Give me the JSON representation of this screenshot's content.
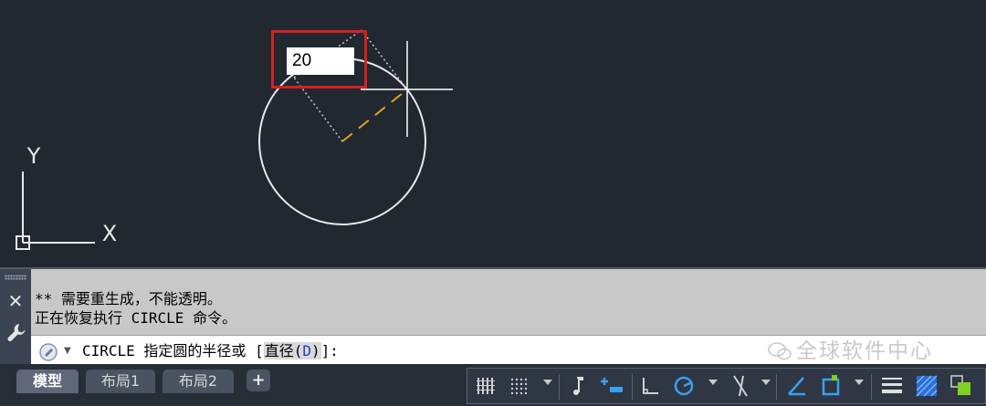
{
  "canvas": {
    "dynamic_input_value": "20",
    "ucs_x_label": "X",
    "ucs_y_label": "Y"
  },
  "command": {
    "history": [
      "** 需要重生成，不能透明。",
      "正在恢复执行 CIRCLE 命令。"
    ],
    "prompt_prefix": "CIRCLE 指定圆的半径或 [",
    "option_label": "直径(",
    "option_key": "D",
    "option_close": ")",
    "prompt_suffix": "]:"
  },
  "watermark": "全球软件中心",
  "tabs": [
    {
      "label": "模型",
      "active": true
    },
    {
      "label": "布局1",
      "active": false
    },
    {
      "label": "布局2",
      "active": false
    }
  ],
  "tab_add_label": "+",
  "colors": {
    "canvas_bg": "#212830",
    "highlight_box": "#d62020",
    "radius_line": "#e0a020",
    "option_key": "#1a3fc4",
    "status_bg": "#272e38"
  },
  "status_tools": [
    "grid-icon",
    "snap-icon",
    "infer-icon",
    "dynamic-input-icon",
    "ortho-icon",
    "polar-icon",
    "isodraft-icon",
    "osnap-track-icon",
    "osnap-icon",
    "lineweight-icon",
    "transparency-icon",
    "selection-cycle-icon"
  ]
}
